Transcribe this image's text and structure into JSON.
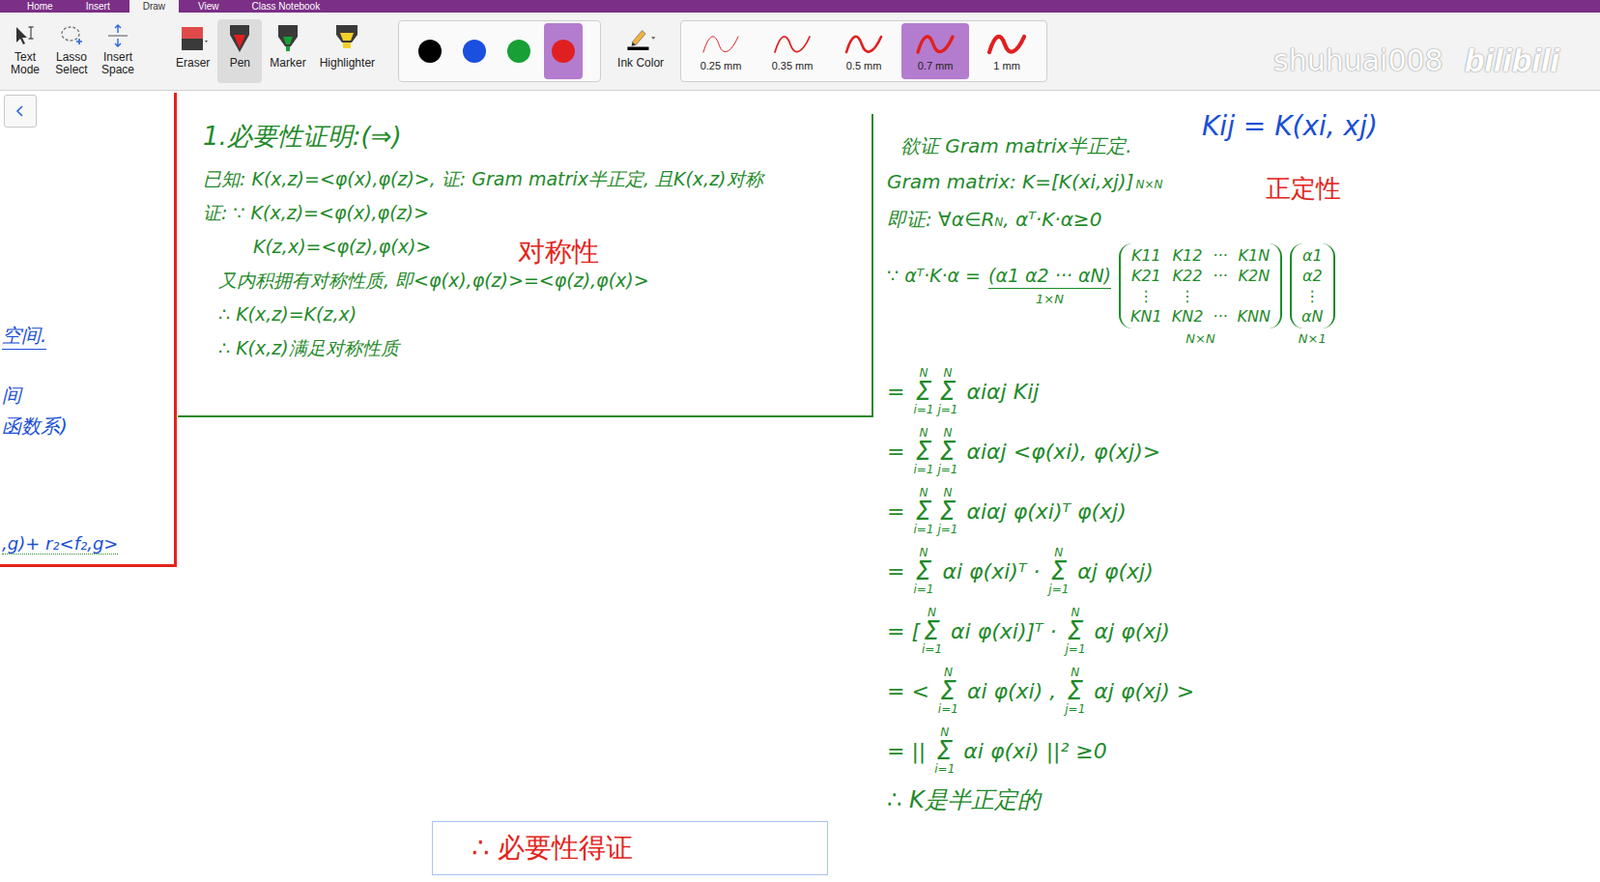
{
  "app_tabs": [
    {
      "label": "Home",
      "selected": false
    },
    {
      "label": "Insert",
      "selected": false
    },
    {
      "label": "Draw",
      "selected": true
    },
    {
      "label": "View",
      "selected": false
    },
    {
      "label": "Class Notebook",
      "selected": false
    }
  ],
  "toolbar": {
    "tools": [
      {
        "label": "Text Mode",
        "selected": false
      },
      {
        "label": "Lasso Select",
        "selected": false
      },
      {
        "label": "Insert Space",
        "selected": false
      },
      {
        "label": "Eraser",
        "selected": false
      },
      {
        "label": "Pen",
        "selected": true
      },
      {
        "label": "Marker",
        "selected": false
      },
      {
        "label": "Highlighter",
        "selected": false
      }
    ],
    "colors": [
      {
        "color": "#000000",
        "selected": false
      },
      {
        "color": "#1a4fe0",
        "selected": false
      },
      {
        "color": "#18a036",
        "selected": false
      },
      {
        "color": "#e02020",
        "selected": true
      }
    ],
    "ink_color_label": "Ink Color",
    "widths": [
      {
        "label": "0.25 mm",
        "selected": false
      },
      {
        "label": "0.35 mm",
        "selected": false
      },
      {
        "label": "0.5 mm",
        "selected": false
      },
      {
        "label": "0.7 mm",
        "selected": true
      },
      {
        "label": "1 mm",
        "selected": false
      }
    ]
  },
  "watermark": {
    "user": "shuhuai008",
    "brand": "bilibili"
  },
  "left_partial_notes": [
    {
      "text": "空间.",
      "kind": "heading"
    },
    {
      "text": "间",
      "kind": "plain"
    },
    {
      "text": "函数系)",
      "kind": "plain"
    },
    {
      "text": ",g)+ r₂<f₂,g>",
      "kind": "formula"
    }
  ],
  "necessity_box": {
    "title": "1.必要性证明:(⇒)",
    "lines": [
      {
        "text": "已知: K(x,z)=<φ(x),φ(z)>, 证: Gram matrix半正定, 且K(x,z)对称",
        "indent": 0
      },
      {
        "text": "证: ∵ K(x,z)=<φ(x),φ(z)>",
        "indent": 0
      },
      {
        "text": "K(z,x)=<φ(z),φ(x)>",
        "indent": 2
      },
      {
        "text": "又内积拥有对称性质, 即<φ(x),φ(z)>=<φ(z),φ(x)>",
        "indent": 1
      },
      {
        "text": "∴ K(x,z)=K(z,x)",
        "indent": 1
      },
      {
        "text": "∴ K(x,z)满足对称性质",
        "indent": 1
      }
    ],
    "annotation": "对称性"
  },
  "right_column": {
    "definition": "Kij = K(xi, xj)",
    "annotation": "正定性",
    "header_lines": [
      [
        {
          "k": "text",
          "t": "欲证 Gram matrix半正定."
        }
      ],
      [
        {
          "k": "text",
          "t": "Gram matrix: K=[K(xi,xj)]"
        },
        {
          "k": "sub",
          "t": "N×N"
        }
      ],
      [
        {
          "k": "text",
          "t": "即证: ∀α∈R"
        },
        {
          "k": "sup",
          "t": "N"
        },
        {
          "k": "text",
          "t": ", αᵀ·K·α≥0"
        }
      ]
    ],
    "matrix_line": {
      "prefix": "∵ αᵀ·K·α =",
      "row_vector": "(α1 α2 ··· αN)",
      "row_dim": "1×N",
      "matrix": [
        [
          "K11",
          "K12",
          "···",
          "K1N"
        ],
        [
          "K21",
          "K22",
          "···",
          "K2N"
        ],
        [
          "⋮",
          "⋮",
          "",
          ""
        ],
        [
          "KN1",
          "KN2",
          "···",
          "KNN"
        ]
      ],
      "matrix_dim": "N×N",
      "column": [
        "α1",
        "α2",
        "⋮",
        "αN"
      ],
      "column_dim": "N×1"
    },
    "equations": [
      [
        {
          "k": "text",
          "t": "= "
        },
        {
          "k": "sum",
          "t": "Σ",
          "hi": "N",
          "lo": "i=1"
        },
        {
          "k": "sum",
          "t": "Σ",
          "hi": "N",
          "lo": "j=1"
        },
        {
          "k": "text",
          "t": " αiαj Kij"
        }
      ],
      [
        {
          "k": "text",
          "t": "= "
        },
        {
          "k": "sum",
          "t": "Σ",
          "hi": "N",
          "lo": "i=1"
        },
        {
          "k": "sum",
          "t": "Σ",
          "hi": "N",
          "lo": "j=1"
        },
        {
          "k": "text",
          "t": " αiαj <φ(xi), φ(xj)>"
        }
      ],
      [
        {
          "k": "text",
          "t": "= "
        },
        {
          "k": "sum",
          "t": "Σ",
          "hi": "N",
          "lo": "i=1"
        },
        {
          "k": "sum",
          "t": "Σ",
          "hi": "N",
          "lo": "j=1"
        },
        {
          "k": "text",
          "t": " αiαj φ(xi)ᵀ φ(xj)"
        }
      ],
      [
        {
          "k": "text",
          "t": "= "
        },
        {
          "k": "sum",
          "t": "Σ",
          "hi": "N",
          "lo": "i=1"
        },
        {
          "k": "text",
          "t": " αi φ(xi)ᵀ · "
        },
        {
          "k": "sum",
          "t": "Σ",
          "hi": "N",
          "lo": "j=1"
        },
        {
          "k": "text",
          "t": " αj φ(xj)"
        }
      ],
      [
        {
          "k": "text",
          "t": "= ["
        },
        {
          "k": "sum",
          "t": "Σ",
          "hi": "N",
          "lo": "i=1"
        },
        {
          "k": "text",
          "t": " αi φ(xi)]ᵀ · "
        },
        {
          "k": "sum",
          "t": "Σ",
          "hi": "N",
          "lo": "j=1"
        },
        {
          "k": "text",
          "t": " αj φ(xj)"
        }
      ],
      [
        {
          "k": "text",
          "t": "= < "
        },
        {
          "k": "sum",
          "t": "Σ",
          "hi": "N",
          "lo": "i=1"
        },
        {
          "k": "text",
          "t": " αi φ(xi) , "
        },
        {
          "k": "sum",
          "t": "Σ",
          "hi": "N",
          "lo": "j=1"
        },
        {
          "k": "text",
          "t": " αj φ(xj) >"
        }
      ],
      [
        {
          "k": "text",
          "t": "= || "
        },
        {
          "k": "sum",
          "t": "Σ",
          "hi": "N",
          "lo": "i=1"
        },
        {
          "k": "text",
          "t": " αi φ(xi) ||² ≥0"
        }
      ]
    ],
    "conclusion": "∴ K是半正定的"
  },
  "caption": "∴ 必要性得证"
}
